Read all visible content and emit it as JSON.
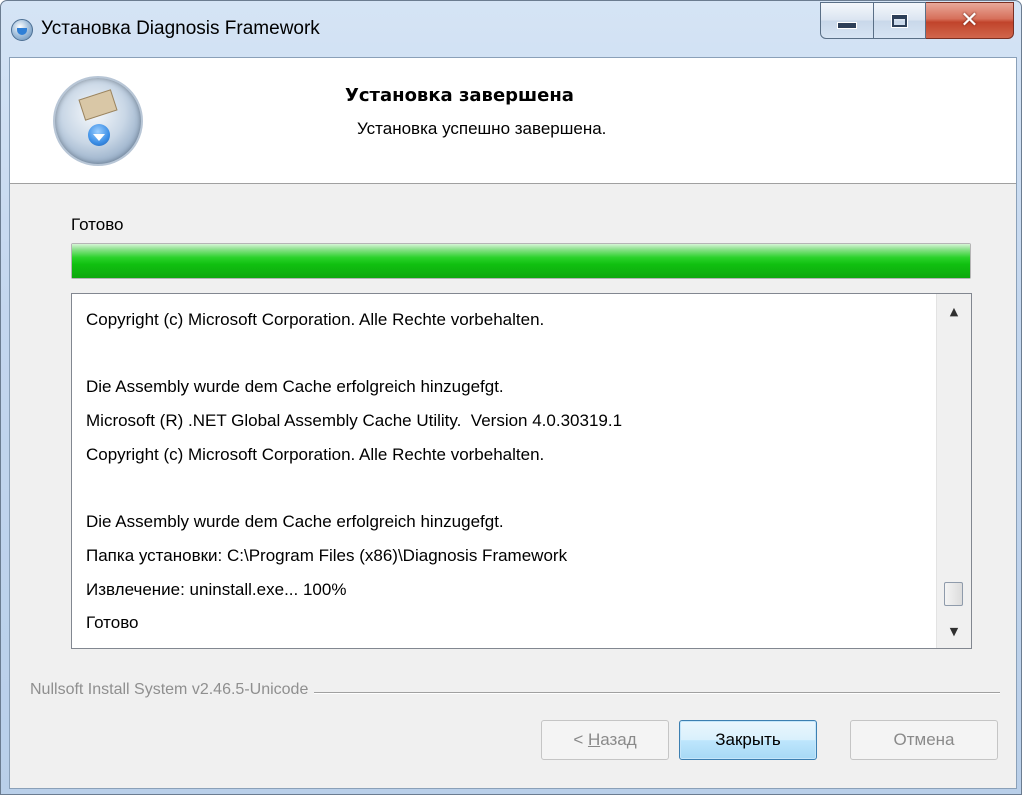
{
  "window": {
    "title": "Установка Diagnosis Framework"
  },
  "header": {
    "title": "Установка завершена",
    "subtitle": "Установка успешно завершена."
  },
  "status": {
    "label": "Готово",
    "progress_fraction": 1.0
  },
  "log": {
    "lines": [
      "Copyright (c) Microsoft Corporation. Alle Rechte vorbehalten.",
      "",
      "Die Assembly wurde dem Cache erfolgreich hinzugefgt.",
      "Microsoft (R) .NET Global Assembly Cache Utility.  Version 4.0.30319.1",
      "Copyright (c) Microsoft Corporation. Alle Rechte vorbehalten.",
      "",
      "Die Assembly wurde dem Cache erfolgreich hinzugefgt.",
      "Папка установки: C:\\Program Files (x86)\\Diagnosis Framework",
      "Извлечение: uninstall.exe... 100%",
      "Готово"
    ]
  },
  "footer": {
    "branding": "Nullsoft Install System v2.46.5-Unicode",
    "back_prefix": "< ",
    "back_mnemonic": "Н",
    "back_rest": "азад",
    "close_label": "Закрыть",
    "cancel_label": "Отмена"
  },
  "colors": {
    "progress": "#10c010",
    "title_close": "#c1442b",
    "default_button_border": "#3c7fb1"
  },
  "icons": {
    "app": "installer-disk-icon",
    "minimize": "minimize-icon",
    "maximize": "maximize-icon",
    "close": "close-icon",
    "scroll_up": "arrow-up-icon",
    "scroll_down": "arrow-down-icon"
  }
}
